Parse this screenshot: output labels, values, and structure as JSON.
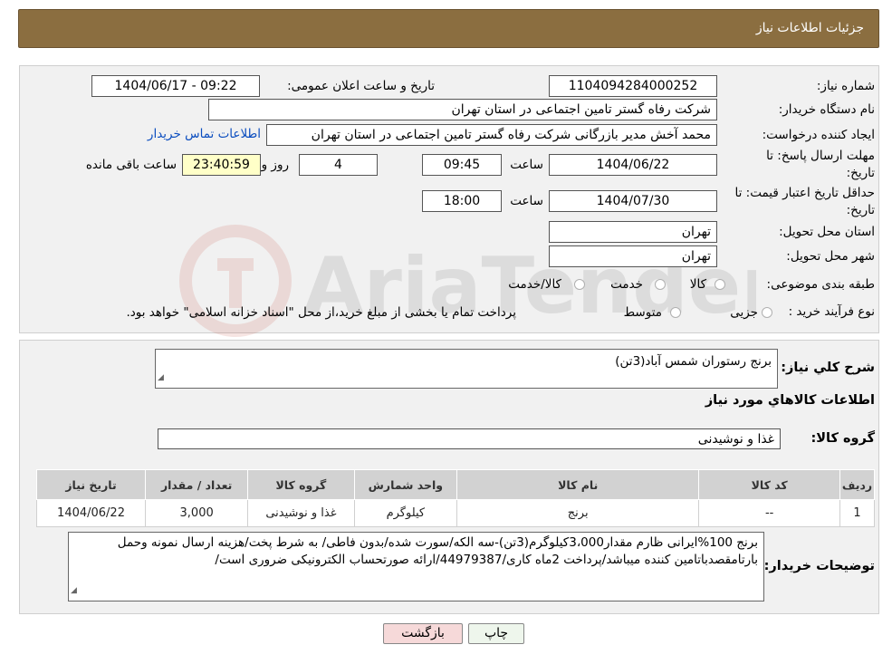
{
  "header": {
    "title": "جزئیات اطلاعات نیاز"
  },
  "form": {
    "need_number_label": "شماره نیاز:",
    "need_number": "1104094284000252",
    "announce_label": "تاریخ و ساعت اعلان عمومی:",
    "announce_value": "1404/06/17 - 09:22",
    "buyer_org_label": "نام دستگاه خریدار:",
    "buyer_org": "شرکت رفاه گستر تامین اجتماعی در استان تهران",
    "creator_label": "ایجاد کننده درخواست:",
    "creator": "محمد آخش مدیر بازرگانی شرکت رفاه گستر تامین اجتماعی در استان تهران",
    "contact_link": "اطلاعات تماس خریدار",
    "deadline_label": "مهلت ارسال پاسخ: تا تاریخ:",
    "deadline_date": "1404/06/22",
    "time_label": "ساعت",
    "deadline_time": "09:45",
    "days_value": "4",
    "days_label": "روز و",
    "remaining_time": "23:40:59",
    "remaining_label": "ساعت باقی مانده",
    "validity_label": "حداقل تاریخ اعتبار قیمت: تا تاریخ:",
    "validity_date": "1404/07/30",
    "validity_time": "18:00",
    "province_label": "استان محل تحویل:",
    "province": "تهران",
    "city_label": "شهر محل تحویل:",
    "city": "تهران",
    "category_label": "طبقه بندی موضوعی:",
    "category_options": [
      "کالا",
      "خدمت",
      "کالا/خدمت"
    ],
    "process_label": "نوع فرآیند خرید :",
    "process_options": [
      "جزیی",
      "متوسط"
    ],
    "process_note": "پرداخت تمام یا بخشی از مبلغ خرید،از محل \"اسناد خزانه اسلامی\" خواهد بود."
  },
  "summary": {
    "label": "شرح کلي نياز:",
    "value": "برنج رستوران شمس آباد(3تن)",
    "goods_info_title": "اطلاعات کالاهاي مورد نياز",
    "group_label": "گروه کالا:",
    "group_value": "غذا و نوشیدنی"
  },
  "table": {
    "headers": [
      "رديف",
      "کد کالا",
      "نام کالا",
      "واحد شمارش",
      "گروه کالا",
      "تعداد / مقدار",
      "تاریخ نیاز"
    ],
    "rows": [
      [
        "1",
        "--",
        "برنج",
        "کیلوگرم",
        "غذا و نوشیدنی",
        "3,000",
        "1404/06/22"
      ]
    ]
  },
  "notes": {
    "label": "توضیحات خریدار:",
    "value": "برنج 100%ایرانی ظارم مقدار3،000کیلوگرم(3تن)-سه الکه/سورت شده/بدون فاطی/ به شرط پخت/هزینه ارسال نمونه وحمل بارتامقصدباتامین کننده میباشد/پرداخت 2ماه کاری/44979387/ارائه صورتحساب الکترونیکی ضروری است/"
  },
  "buttons": {
    "print": "چاپ",
    "back": "بازگشت"
  },
  "colors": {
    "header_bg": "#8b6e40",
    "link": "#0b4dbf",
    "back_button_bg": "#f6d9d9"
  }
}
